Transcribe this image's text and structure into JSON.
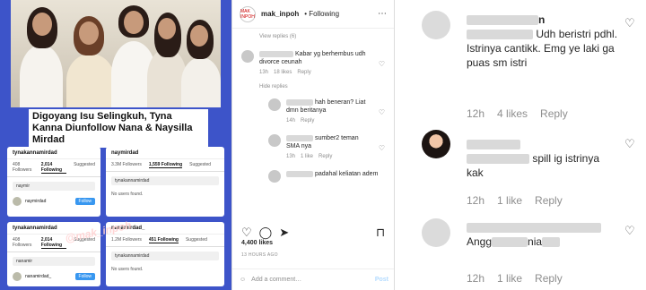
{
  "left": {
    "headline": "Digoyang Isu Selingkuh, Tyna Kanna Diunfollow Nana & Naysilla Mirdad",
    "watermark": "@mak_inpoh",
    "shots": [
      {
        "title": "tynakannamirdad",
        "stats": [
          "408 Followers",
          "2,014 Following",
          "Suggested"
        ],
        "search": "naymir",
        "row": "naymirdad",
        "action": "Follow"
      },
      {
        "title": "naymirdad",
        "stats": [
          "3.3M Followers",
          "1,559 Following",
          "Suggested"
        ],
        "search": "tynakannamirdad",
        "note": "No users found."
      },
      {
        "title": "tynakannamirdad",
        "stats": [
          "408 Followers",
          "2,014 Following",
          "Suggested"
        ],
        "search": "nanamir",
        "row": "nanamirdad_",
        "action": "Follow"
      },
      {
        "title": "nanamirdad_",
        "stats": [
          "1.2M Followers",
          "451 Following",
          "Suggested"
        ],
        "search": "tynakannamirdad",
        "note": "No users found."
      }
    ]
  },
  "mid": {
    "username": "mak_inpoh",
    "follow": "• Following",
    "avatar_text": "MAK INPOH",
    "view_replies": "View replies (6)",
    "comments": [
      {
        "text": "Kabar yg berhembus udh divorce ceunah",
        "time": "13h",
        "likes": "18 likes",
        "reply": "Reply"
      },
      {
        "text": "hah beneran? Liat dmn beritanya",
        "time": "14h",
        "likes": "",
        "reply": "Reply"
      },
      {
        "text": "sumber2 teman SMA nya",
        "time": "13h",
        "likes": "1 like",
        "reply": "Reply"
      },
      {
        "text": "padahal keliatan adem",
        "time": "",
        "likes": "",
        "reply": ""
      }
    ],
    "hide_replies": "Hide replies",
    "likes": "4,400 likes",
    "ago": "13 HOURS AGO",
    "add_comment": "Add a comment…",
    "post": "Post"
  },
  "right": {
    "comments": [
      {
        "name_tail": "n",
        "text": "Udh beristri pdhl. Istrinya cantikk. Emg ye laki ga puas sm istri",
        "time": "12h",
        "likes": "4 likes",
        "reply": "Reply"
      },
      {
        "text": "spill ig istrinya kak",
        "time": "12h",
        "likes": "1 like",
        "reply": "Reply"
      },
      {
        "text_head": "Angg",
        "text_tail": "nia",
        "time": "12h",
        "likes": "1 like",
        "reply": "Reply"
      }
    ]
  }
}
